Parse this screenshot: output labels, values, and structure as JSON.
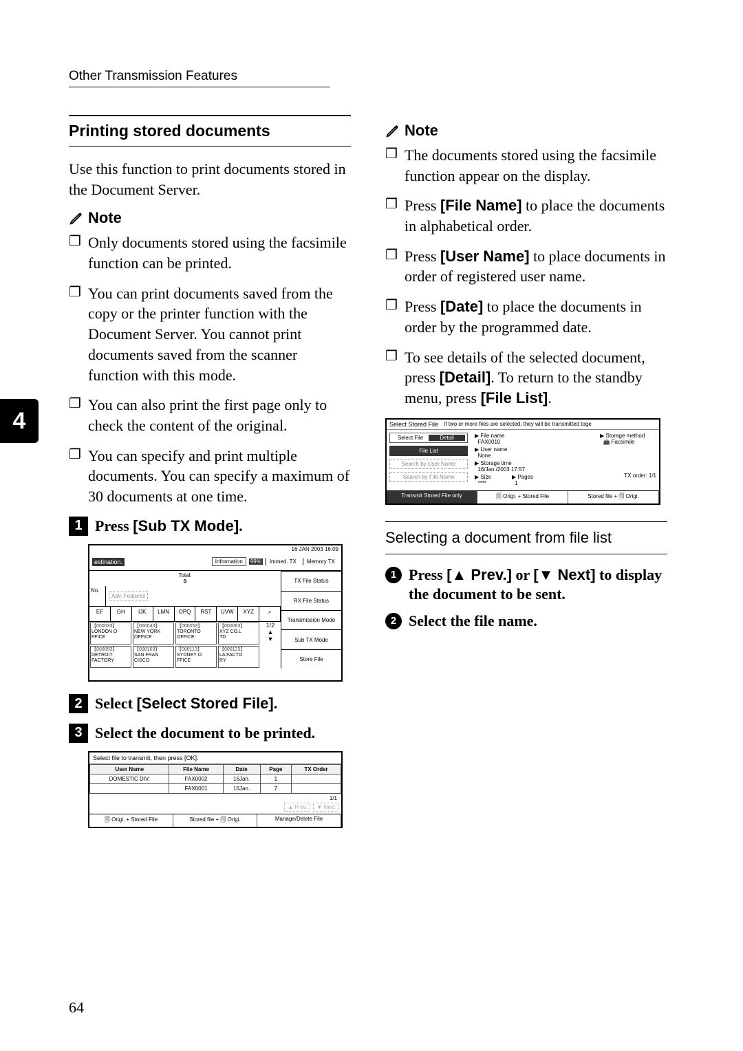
{
  "header": "Other Transmission Features",
  "side_tab": "4",
  "page_number": "64",
  "left": {
    "title": "Printing stored documents",
    "intro": "Use this function to print documents stored in the Document Server.",
    "note_label": "Note",
    "notes": [
      "Only documents stored using the facsimile function can be printed.",
      "You can print documents saved from the copy or the printer function with the Document Server. You cannot print documents saved from the scanner function with this mode.",
      "You can also print the first page only to check the content of the original.",
      "You can specify and print multiple documents. You can specify a maximum of 30 documents at one time."
    ],
    "step1_prefix": "Press ",
    "step1_ui": "[Sub TX Mode]",
    "step1_suffix": ".",
    "step2_prefix": "Select ",
    "step2_ui": "[Select Stored File]",
    "step2_suffix": ".",
    "step3": "Select the document to be printed.",
    "shot1": {
      "datetime": "16 JAN  2003 16:09",
      "dest": "estination.",
      "info": "Information",
      "pct": "99%",
      "immed": "Immed.\nTX",
      "memory": "Memory\nTX",
      "total": "Total:",
      "total_val": "0",
      "no": "No.",
      "adv": "Adv. Features",
      "txfs": "TX File Status",
      "rxfs": "RX File Status",
      "keys": [
        "EF",
        "GH",
        "IJK",
        "LMN",
        "OPQ",
        "RST",
        "UVW",
        "XYZ",
        "⌕"
      ],
      "entries_row1": [
        {
          "code": "【000033】",
          "name": "LONDON O\nFFICE"
        },
        {
          "code": "【000043】",
          "name": "NEW YORK\nOFFICE"
        },
        {
          "code": "【000053】",
          "name": "TORONTO\nOFFICE"
        },
        {
          "code": "【000063】",
          "name": "XYZ CO.L\nTD"
        }
      ],
      "entries_row2": [
        {
          "code": "【000093】",
          "name": "DETROIT\nFACTORY"
        },
        {
          "code": "【000103】",
          "name": "SAN FRAN\nCISCO"
        },
        {
          "code": "【000113】",
          "name": "SYDNEY O\nFFICE"
        },
        {
          "code": "【000123】",
          "name": "LA FACTO\nRY"
        }
      ],
      "page_ind": "1/2",
      "tm": "Transmission Mode",
      "stx": "Sub TX Mode",
      "sf": "Store File"
    },
    "shot2": {
      "head": "Select file to transmit, then press [OK].",
      "cols": [
        "User Name",
        "File Name",
        "Date",
        "Page",
        "TX Order"
      ],
      "rows": [
        [
          "DOMESTIC DIV.",
          "FAX0002",
          "16Jan.",
          "1",
          ""
        ],
        [
          "",
          "FAX0001",
          "16Jan.",
          "7",
          ""
        ]
      ],
      "page_ind": "1/1",
      "prev": "▲ Prev.",
      "next": "▼ Next",
      "foot": [
        "🗐 Origi. + Stored File",
        "Stored file + 🗐 Origi.",
        "Manage/Delete File"
      ]
    }
  },
  "right": {
    "note_label": "Note",
    "notes": [
      {
        "plain": "The documents stored using the facsimile function appear on the display."
      },
      {
        "pre": "Press ",
        "ui": "[File Name]",
        "post": " to place the documents in alphabetical order."
      },
      {
        "pre": "Press ",
        "ui": "[User Name]",
        "post": " to place documents in order of registered user name."
      },
      {
        "pre": "Press ",
        "ui": "[Date]",
        "post": " to place the documents in order by the programmed date."
      },
      {
        "pre": "To see details of the selected document, press ",
        "ui": "[Detail]",
        "post": ". To return to the standby menu, press ",
        "ui2": "[File List]",
        "post2": "."
      }
    ],
    "shot3": {
      "top_l": "Select Stored File",
      "top_r": "If two or more files are selected, they will be transmitted toge",
      "sel_file": "Select File",
      "detail": "Detail",
      "file_list": "File List",
      "sbu": "Search by User Name",
      "sbf": "Search by File Name",
      "fn": "▶ File name",
      "fn_v": "FAX0010",
      "un": "▶ User name",
      "un_v": "None",
      "st": "▶ Storage time",
      "st_v": "16/Jan./2003 17:57",
      "sz": "▶ Size",
      "sz_v": "****",
      "pg": "▶ Pages",
      "pg_v": "1",
      "sm": "▶ Storage method",
      "sm_v": "📠 Facsimile",
      "txo": "TX order:",
      "txo_v": "1/1",
      "foot_l": "Transmit Stored File only",
      "foot_m": "🗐 Origi. + Stored File",
      "foot_r": "Stored file + 🗐 Origi."
    },
    "sel_heading": "Selecting a document from file list",
    "c1_pre": "Press ",
    "c1_ui1": "[▲ Prev.]",
    "c1_mid": " or ",
    "c1_ui2": "[▼ Next]",
    "c1_post": " to display the document to be sent.",
    "c2": "Select the file name."
  }
}
